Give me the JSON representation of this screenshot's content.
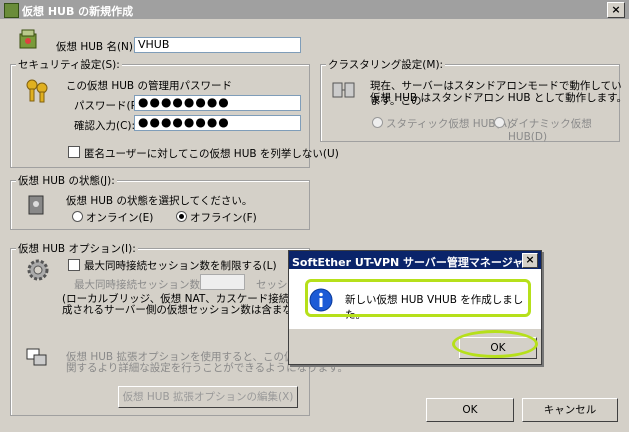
{
  "window": {
    "title": "仮想 HUB の新規作成",
    "close": "×"
  },
  "hub_name": {
    "label": "仮想 HUB 名(N):",
    "value": "VHUB"
  },
  "security": {
    "legend": "セキュリティ設定(S):",
    "desc": "この仮想 HUB の管理用パスワード",
    "password_label": "パスワード(P):",
    "password_value": "●●●●●●●●",
    "confirm_label": "確認入力(C):",
    "confirm_value": "●●●●●●●●",
    "anon_label": "匿名ユーザーに対してこの仮想 HUB を列挙しない(U)"
  },
  "cluster": {
    "legend": "クラスタリング設定(M):",
    "desc1": "現在、サーバーはスタンドアロンモードで動作しています。この",
    "desc2": "仮想 HUB はスタンドアロン HUB として動作します。",
    "static_label": "スタティック仮想 HUB(A)",
    "dynamic_label": "ダイナミック仮想 HUB(D)"
  },
  "status": {
    "legend": "仮想 HUB の状態(J):",
    "desc": "仮想 HUB の状態を選択してください。",
    "online": "オンライン(E)",
    "offline": "オフライン(F)"
  },
  "options": {
    "legend": "仮想 HUB オプション(I):",
    "limit_label": "最大同時接続セッション数を制限する(L)",
    "max_label": "最大同時接続セッション数(X):",
    "session_unit": "セッショ",
    "note1": "(ローカルブリッジ、仮想 NAT、カスケード接続などによって",
    "note2": "成されるサーバー側の仮想セッション数は含まない)",
    "ext1": "仮想 HUB 拡張オプションを使用すると、この仮想 HUB の",
    "ext2": "関するより詳細な設定を行うことができるようになります。",
    "ext_button": "仮想 HUB 拡張オプションの編集(X)"
  },
  "buttons": {
    "ok": "OK",
    "cancel": "キャンセル"
  },
  "message_box": {
    "title": "SoftEther UT-VPN サーバー管理マネージャ",
    "close": "×",
    "text": "新しい仮想 HUB VHUB を作成しました。",
    "ok": "OK"
  },
  "colors": {
    "highlight": "#b6e01a",
    "msg_title": "#0a246a",
    "info_icon": "#1c5bd6"
  }
}
